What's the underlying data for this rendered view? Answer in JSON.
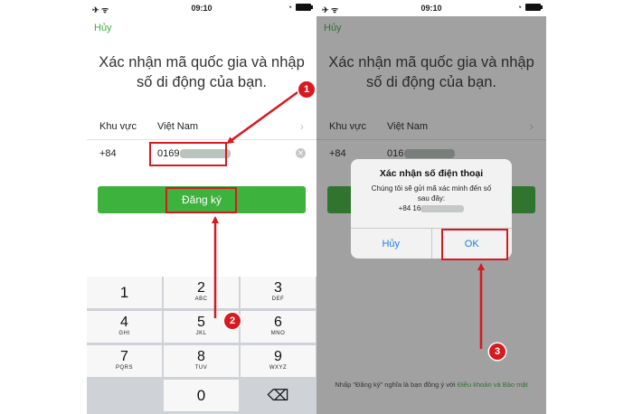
{
  "left_screen": {
    "status": {
      "time": "09:10",
      "left_icons": "✈ ᯤ",
      "right_icons": "◔"
    },
    "cancel_label": "Hủy",
    "heading_line1": "Xác nhận mã quốc gia và nhập",
    "heading_line2": "số di động của bạn.",
    "region_label": "Khu vực",
    "region_value": "Việt Nam",
    "country_code": "+84",
    "phone_value": "0169",
    "register_label": "Đăng ký",
    "keys": [
      {
        "digit": "1",
        "letters": ""
      },
      {
        "digit": "2",
        "letters": "ABC"
      },
      {
        "digit": "3",
        "letters": "DEF"
      },
      {
        "digit": "4",
        "letters": "GHI"
      },
      {
        "digit": "5",
        "letters": "JKL"
      },
      {
        "digit": "6",
        "letters": "MNO"
      },
      {
        "digit": "7",
        "letters": "PQRS"
      },
      {
        "digit": "8",
        "letters": "TUV"
      },
      {
        "digit": "9",
        "letters": "WXYZ"
      },
      {
        "digit": "0",
        "letters": ""
      }
    ],
    "backspace_glyph": "⌫"
  },
  "right_screen": {
    "status": {
      "time": "09:10",
      "left_icons": "✈ ᯤ",
      "right_icons": "◔"
    },
    "cancel_label": "Hủy",
    "heading_line1": "Xác nhận mã quốc gia và nhập",
    "heading_line2": "số di động của bạn.",
    "region_label": "Khu vực",
    "region_value": "Việt Nam",
    "country_code": "+84",
    "phone_value": "016",
    "dialog": {
      "title": "Xác nhận số điện thoại",
      "message": "Chúng tôi sẽ gửi mã xác minh đến số sau đây:",
      "number": "+84 16",
      "cancel_label": "Hủy",
      "ok_label": "OK"
    },
    "footer_prefix": "Nhấp \"Đăng ký\" nghĩa là bạn đồng ý với",
    "footer_link": "Điều khoản và Bảo mật"
  },
  "annotations": {
    "step1": "1",
    "step2": "2",
    "step3": "3"
  },
  "colors": {
    "accent_green": "#3db23d",
    "annotation_red": "#d71920",
    "ios_blue": "#1a7ee8"
  }
}
